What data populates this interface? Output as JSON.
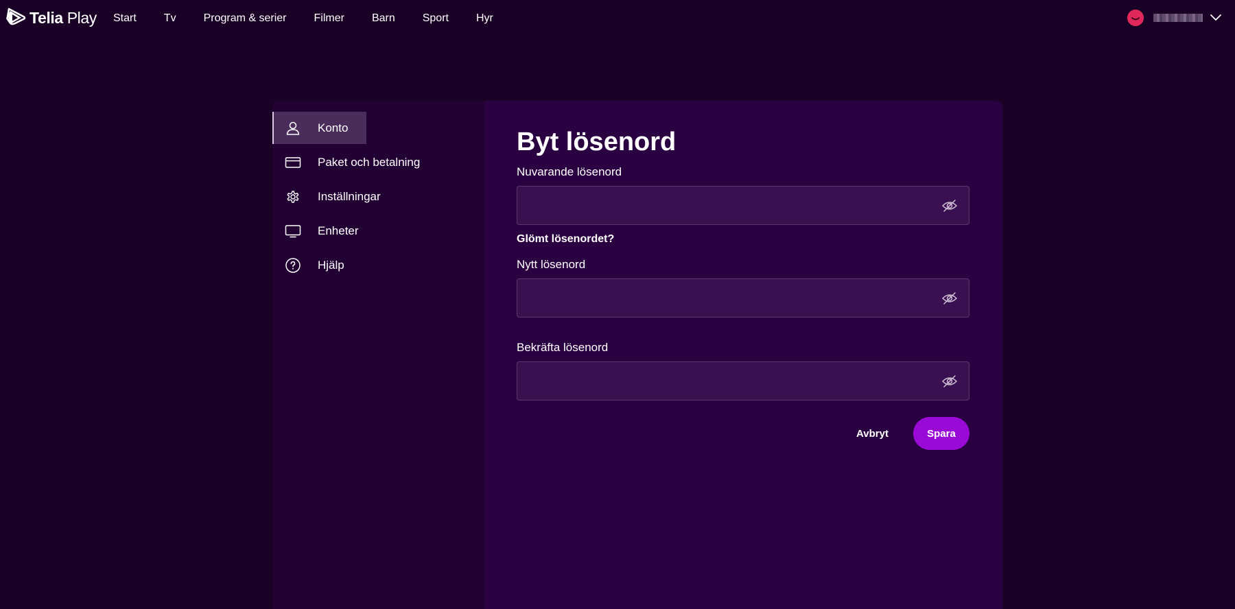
{
  "brand": {
    "name_bold": "Telia",
    "name_regular": " Play"
  },
  "nav": {
    "items": [
      {
        "label": "Start"
      },
      {
        "label": "Tv"
      },
      {
        "label": "Program & serier"
      },
      {
        "label": "Filmer"
      },
      {
        "label": "Barn"
      },
      {
        "label": "Sport"
      },
      {
        "label": "Hyr"
      }
    ]
  },
  "user": {
    "avatar_icon": "smiley-avatar-icon",
    "menu_icon": "chevron-down-icon"
  },
  "sidebar": {
    "items": [
      {
        "label": "Konto",
        "icon": "user-icon",
        "active": true
      },
      {
        "label": "Paket och betalning",
        "icon": "credit-card-icon",
        "active": false
      },
      {
        "label": "Inställningar",
        "icon": "gear-icon",
        "active": false
      },
      {
        "label": "Enheter",
        "icon": "monitor-icon",
        "active": false
      },
      {
        "label": "Hjälp",
        "icon": "help-circle-icon",
        "active": false
      }
    ]
  },
  "form": {
    "title": "Byt lösenord",
    "current_password": {
      "label": "Nuvarande lösenord",
      "value": ""
    },
    "forgot_link": "Glömt lösenordet?",
    "new_password": {
      "label": "Nytt lösenord",
      "value": ""
    },
    "confirm_password": {
      "label": "Bekräfta lösenord",
      "value": ""
    },
    "cancel_label": "Avbryt",
    "save_label": "Spara"
  },
  "colors": {
    "background": "#1a0226",
    "sidebar": "#220233",
    "main": "#2a0141",
    "accent": "#9a0ad6",
    "avatar": "#e0285a"
  }
}
